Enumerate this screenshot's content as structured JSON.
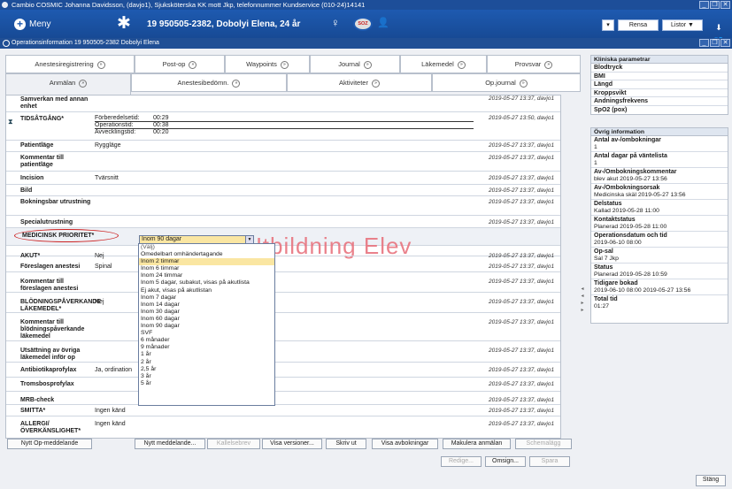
{
  "titlebar": {
    "text": "Cambio COSMIC Johanna  Davidsson, (davjo1), Sjuksköterska KK mott Jkp, telefonnummer Kundservice (010-24)14141"
  },
  "appbar": {
    "menu_label": "Meny",
    "patient": "19 950505-2382,  Dobolyi Elena,  24 år",
    "status_badge": "SOZ",
    "rensa": "Rensa",
    "listor": "Listor ▼",
    "dropdown_icon": "▾"
  },
  "opbar": {
    "title": "Operationsinformation 19 950505-2382 Dobolyi Elena"
  },
  "tabs_row1": [
    "Anestesiregistrering",
    "Post-op",
    "Waypoints",
    "Journal",
    "Läkemedel",
    "Provsvar"
  ],
  "tabs_row2": [
    "Anmälan",
    "Anestesibedömn.",
    "Aktiviteter",
    "Op.journal"
  ],
  "rows": {
    "r0": {
      "label": "Samverkan med annan enhet",
      "ts": "2019-05-27 13:37, davjo1"
    },
    "r1": {
      "label": "TIDSÅTGÅNG*",
      "ts": "2019-05-27 13:50, davjo1",
      "sub": [
        {
          "k": "Förberedelsetid:",
          "v": "00:29"
        },
        {
          "k": "Operationstid:",
          "v": "00:38"
        },
        {
          "k": "Avvecklingstid:",
          "v": "00:20"
        }
      ]
    },
    "r2": {
      "label": "Patientläge",
      "val": "Ryggläge",
      "ts": "2019-05-27 13:37, davjo1"
    },
    "r3": {
      "label": "Kommentar till patientläge",
      "ts": "2019-05-27 13:37, davjo1"
    },
    "r4": {
      "label": "Incision",
      "val": "Tvärsnitt",
      "ts": "2019-05-27 13:37, davjo1"
    },
    "r5": {
      "label": "Bild",
      "ts": "2019-05-27 13:37, davjo1"
    },
    "r6": {
      "label": "Bokningsbar utrustning",
      "ts": "2019-05-27 13:37, davjo1"
    },
    "r7": {
      "label": "Specialutrustning",
      "ts": "2019-05-27 13:37, davjo1"
    },
    "r8": {
      "label": "MEDICINSK PRIORITET*",
      "dropdown_value": "Inom 90 dagar",
      "watermark": "Utbildning Elev"
    },
    "r9": {
      "label": "AKUT*",
      "val": "Nej",
      "ts": "2019-05-27 13:37, davjo1"
    },
    "r10": {
      "label": "Föreslagen anestesi",
      "val": "Spinal",
      "ts": "2019-05-27 13:37, davjo1"
    },
    "r11": {
      "label": "Kommentar till föreslagen anestesi",
      "ts": "2019-05-27 13:37, davjo1"
    },
    "r12": {
      "label": "BLÖDNINGSPÅVERKANDE LÄKEMEDEL*",
      "val": "Nej",
      "ts": "2019-05-27 13:37, davjo1"
    },
    "r13": {
      "label": "Kommentar till blödningspåverkande läkemedel",
      "ts": "2019-05-27 13:37, davjo1"
    },
    "r14": {
      "label": "Utsättning av övriga läkemedel inför op",
      "ts": "2019-05-27 13:37, davjo1"
    },
    "r15": {
      "label": "Antibiotikaprofylax",
      "val": "Ja, ordination",
      "ts": "2019-05-27 13:37, davjo1"
    },
    "r16": {
      "label": "Tromsbosprofylax",
      "ts": "2019-05-27 13:37, davjo1"
    },
    "r17": {
      "label": "MRB-check",
      "ts": "2019-05-27 13:37, davjo1"
    },
    "r18": {
      "label": "SMITTA*",
      "val": "Ingen känd",
      "ts": "2019-05-27 13:37, davjo1"
    },
    "r19": {
      "label": "ALLERGI/ÖVERKÄNSLIGHET*",
      "val": "Ingen känd",
      "ts": "2019-05-27 13:37, davjo1"
    }
  },
  "dropdown_options": [
    "(Välj)",
    "Omedelbart omhändertagande",
    "Inom 2 timmar",
    "Inom 6 timmar",
    "Inom 24 timmar",
    "Inom 5 dagar, subakut, visas på akutlista",
    "Ej akut, visas på akutlistan",
    "Inom 7 dagar",
    "Inom 14 dagar",
    "Inom 30 dagar",
    "Inom 60 dagar",
    "Inom 90 dagar",
    "SVF",
    "6 månader",
    "9 månader",
    "1 år",
    "2 år",
    "2,5 år",
    "3 år",
    "5 år"
  ],
  "clinical": {
    "header": "Kliniska parametrar",
    "items": [
      "Blodtryck",
      "BMI",
      "Längd",
      "Kroppsvikt",
      "Andningsfrekvens",
      "SpO2 (pox)"
    ]
  },
  "other": {
    "header": "Övrig information",
    "items": [
      {
        "k": "Antal av-/ombokningar",
        "v": "1"
      },
      {
        "k": "Antal dagar på väntelista",
        "v": "1"
      },
      {
        "k": "Av-/Ombokningskommentar",
        "v": "blev akut 2019-05-27 13:56"
      },
      {
        "k": "Av-/Ombokningsorsak",
        "v": "Medicinska skäl 2019-05-27 13:56"
      },
      {
        "k": "Delstatus",
        "v": "Kallad 2019-05-28 11:00"
      },
      {
        "k": "Kontaktstatus",
        "v": "Planerad 2019-05-28 11:00"
      },
      {
        "k": "Operationsdatum och tid",
        "v": "2019-06-10 08:00"
      },
      {
        "k": "Op-sal",
        "v": "Sal 7 Jkp"
      },
      {
        "k": "Status",
        "v": "Planerad 2019-05-28 10:59"
      },
      {
        "k": "Tidigare bokad",
        "v": "2019-06-10 08:00 2019-05-27 13:56"
      },
      {
        "k": "Total tid",
        "v": "01:27"
      }
    ]
  },
  "buttons": {
    "nytt_op": "Nytt Op-meddelande",
    "nytt_medd": "Nytt meddelande...",
    "kallelsebrev": "Kallelsebrev",
    "visa_versioner": "Visa versioner...",
    "skriv_ut": "Skriv ut",
    "visa_avbokningar": "Visa avbokningar",
    "makulera": "Makulera anmälan",
    "schemalagg": "Schemalägg",
    "redigera": "Redige...",
    "omsign": "Omsign...",
    "spara": "Spara",
    "stang": "Stäng"
  }
}
